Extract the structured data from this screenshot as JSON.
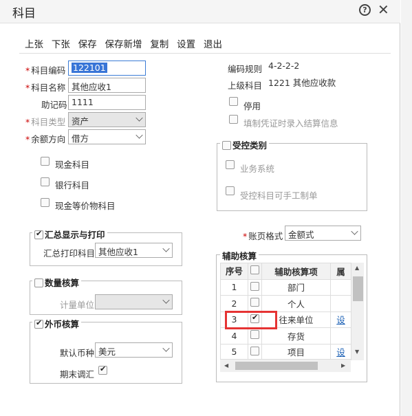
{
  "window": {
    "title": "科目"
  },
  "toolbar": {
    "items": [
      "上张",
      "下张",
      "保存",
      "保存新增",
      "复制",
      "设置",
      "退出"
    ]
  },
  "form": {
    "code_label": "科目编码",
    "code_value": "122101",
    "name_label": "科目名称",
    "name_value": "其他应收1",
    "mnemonic_label": "助记码",
    "mnemonic_value": "1111",
    "type_label": "科目类型",
    "type_value": "资产",
    "balance_label": "余额方向",
    "balance_value": "借方",
    "cash_label": "现金科目",
    "bank_label": "银行科目",
    "cash_eq_label": "现金等价物科目"
  },
  "info": {
    "code_rule_label": "编码规则",
    "code_rule_value": "4-2-2-2",
    "parent_label": "上级科目",
    "parent_value": "1221 其他应收款",
    "disable_label": "停用",
    "settle_label": "填制凭证时录入结算信息"
  },
  "controlled": {
    "title": "受控类别",
    "biz_label": "业务系统",
    "manual_label": "受控科目可手工制单"
  },
  "summary": {
    "title": "汇总显示与打印",
    "print_label": "汇总打印科目",
    "print_value": "其他应收1"
  },
  "quantity": {
    "title": "数量核算",
    "unit_label": "计量单位"
  },
  "currency": {
    "title": "外币核算",
    "default_label": "默认币种",
    "default_value": "美元",
    "period_label": "期末调汇"
  },
  "ledger": {
    "label": "账页格式",
    "value": "金额式"
  },
  "aux": {
    "title": "辅助核算",
    "col_seq": "序号",
    "col_item": "辅助核算项",
    "col_attr": "属",
    "rows": [
      {
        "seq": "1",
        "name": "部门",
        "checked": false,
        "link": ""
      },
      {
        "seq": "2",
        "name": "个人",
        "checked": false,
        "link": ""
      },
      {
        "seq": "3",
        "name": "往来单位",
        "checked": true,
        "link": "设"
      },
      {
        "seq": "4",
        "name": "存货",
        "checked": false,
        "link": ""
      },
      {
        "seq": "5",
        "name": "项目",
        "checked": false,
        "link": "设"
      }
    ]
  }
}
